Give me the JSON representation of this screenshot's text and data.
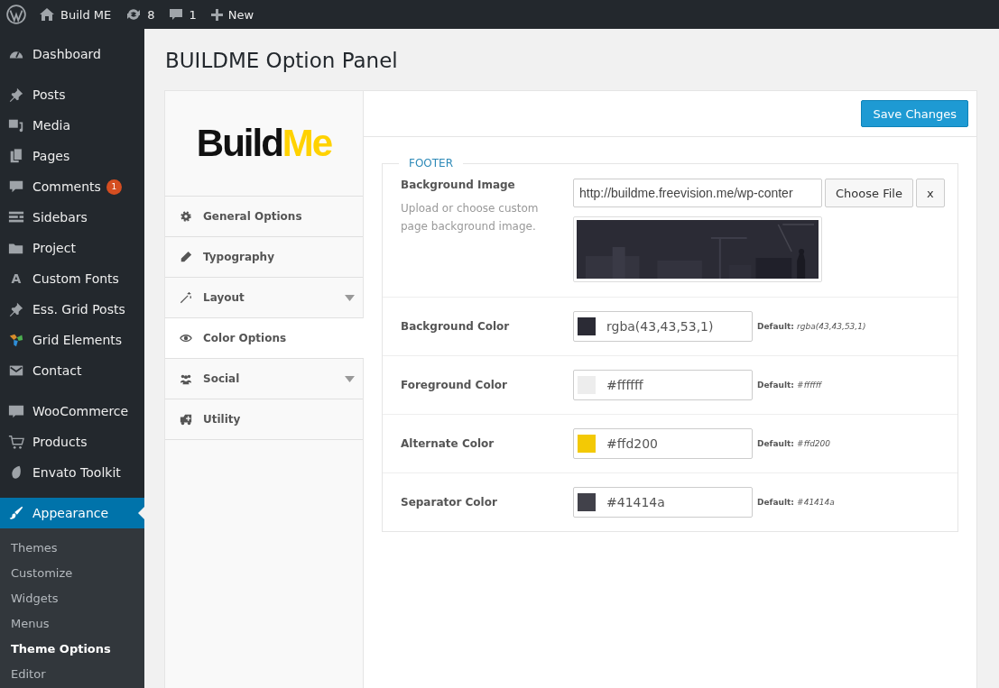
{
  "admin_bar": {
    "site": "Build ME",
    "updates": "8",
    "comments": "1",
    "new": "New"
  },
  "sidebar": {
    "groups": [
      {
        "items": [
          {
            "label": "Dashboard",
            "selected": false
          }
        ]
      },
      {
        "items": [
          {
            "label": "Posts",
            "selected": false
          },
          {
            "label": "Media",
            "selected": false
          },
          {
            "label": "Pages",
            "selected": false
          },
          {
            "label": "Comments",
            "selected": false,
            "badge": "1"
          },
          {
            "label": "Sidebars",
            "selected": false
          },
          {
            "label": "Project",
            "selected": false
          },
          {
            "label": "Custom Fonts",
            "selected": false,
            "icon_glyph": "A"
          },
          {
            "label": "Ess. Grid Posts",
            "selected": false
          },
          {
            "label": "Grid Elements",
            "selected": false
          },
          {
            "label": "Contact",
            "selected": false
          }
        ]
      },
      {
        "items": [
          {
            "label": "WooCommerce",
            "selected": false
          },
          {
            "label": "Products",
            "selected": false
          },
          {
            "label": "Envato Toolkit",
            "selected": false
          }
        ]
      },
      {
        "items": [
          {
            "label": "Appearance",
            "selected": true,
            "children": [
              {
                "label": "Themes",
                "selected": false
              },
              {
                "label": "Customize",
                "selected": false
              },
              {
                "label": "Widgets",
                "selected": false
              },
              {
                "label": "Menus",
                "selected": false
              },
              {
                "label": "Theme Options",
                "selected": true
              },
              {
                "label": "Editor",
                "selected": false
              }
            ]
          }
        ]
      }
    ]
  },
  "page": {
    "title": "BUILDME Option Panel"
  },
  "logo": {
    "first": "Build",
    "second": "Me"
  },
  "option_nav": [
    {
      "label": "General Options",
      "selected": false,
      "expandable": false
    },
    {
      "label": "Typography",
      "selected": false,
      "expandable": false
    },
    {
      "label": "Layout",
      "selected": false,
      "expandable": true
    },
    {
      "label": "Color Options",
      "selected": true,
      "expandable": false
    },
    {
      "label": "Social",
      "selected": false,
      "expandable": true
    },
    {
      "label": "Utility",
      "selected": false,
      "expandable": false
    }
  ],
  "save_button": "Save Changes",
  "section": {
    "legend": "FOOTER",
    "image_option": {
      "label": "Background Image",
      "description": "Upload or choose custom page background image.",
      "value": "http://buildme.freevision.me/wp-conter",
      "choose_button": "Choose File",
      "remove_button": "x"
    },
    "color_options": [
      {
        "label": "Background Color",
        "value": "rgba(43,43,53,1)",
        "color": "#2b2b35",
        "default_label": "Default:",
        "default_value": "rgba(43,43,53,1)"
      },
      {
        "label": "Foreground Color",
        "value": "#ffffff",
        "color": "#ededed",
        "default_label": "Default:",
        "default_value": "#ffffff"
      },
      {
        "label": "Alternate Color",
        "value": "#ffd200",
        "color": "#f3c905",
        "default_label": "Default:",
        "default_value": "#ffd200"
      },
      {
        "label": "Separator Color",
        "value": "#41414a",
        "color": "#41414a",
        "default_label": "Default:",
        "default_value": "#41414a"
      }
    ]
  }
}
